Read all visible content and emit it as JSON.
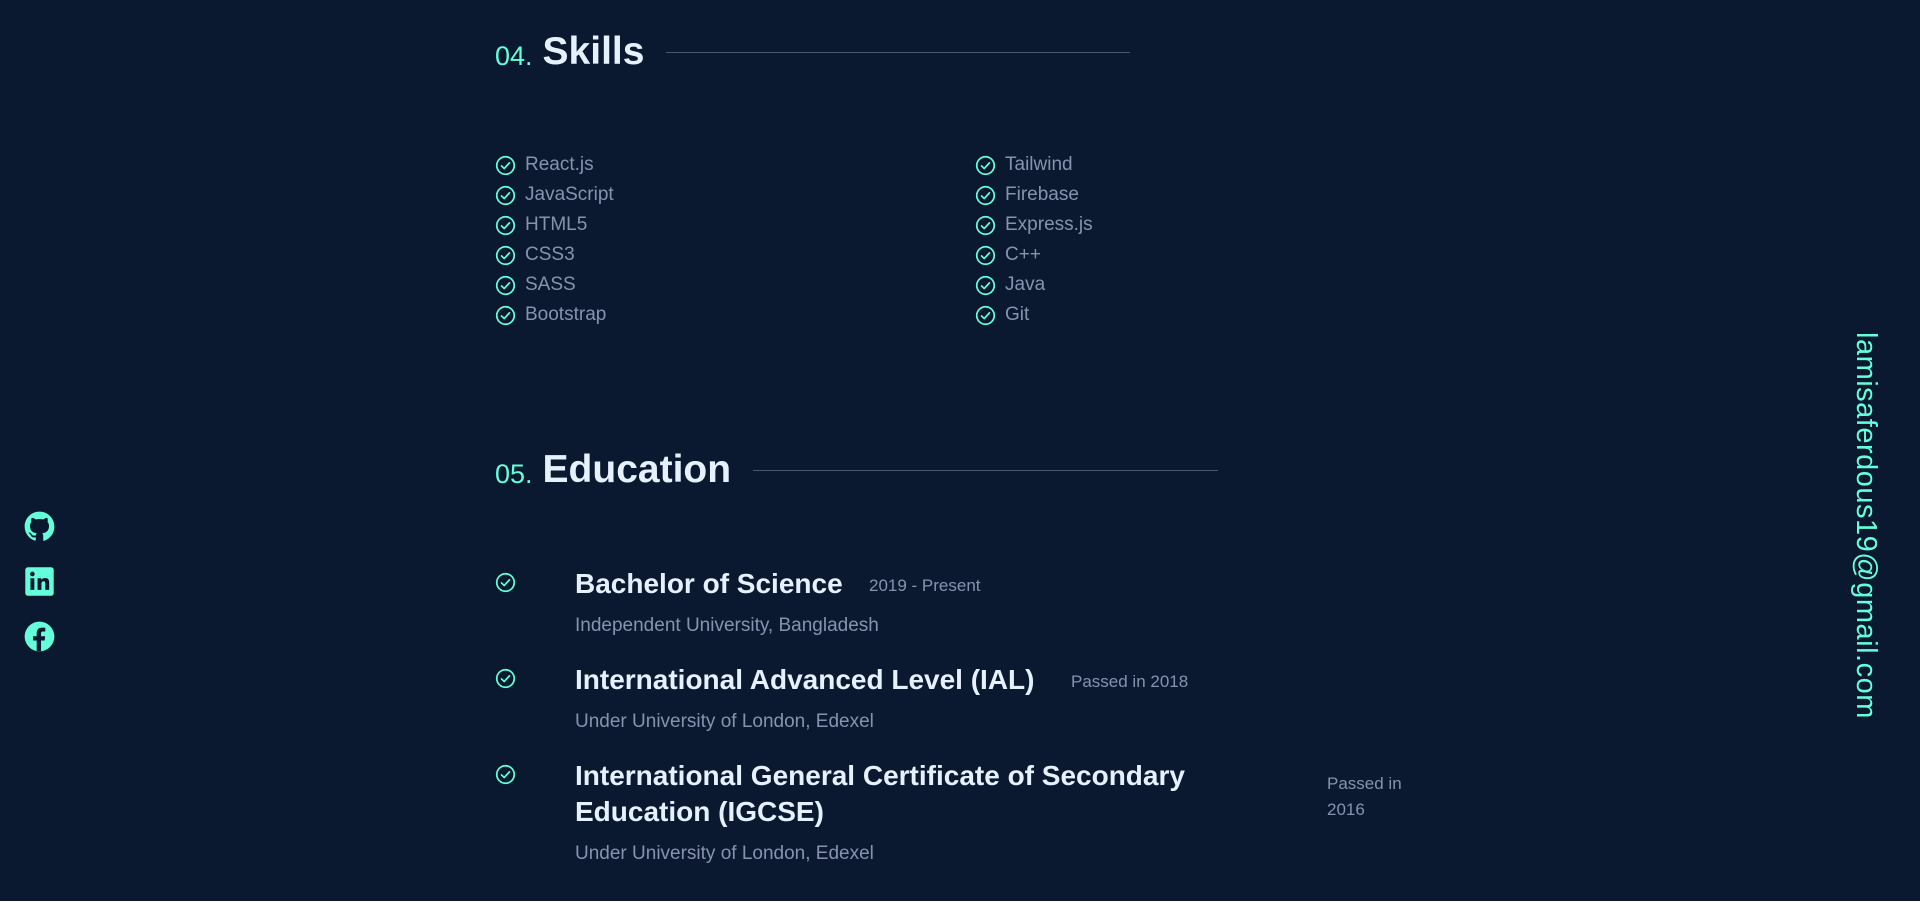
{
  "colors": {
    "background": "#0a192f",
    "accent": "#64ffda",
    "heading": "#e6f1ff",
    "body_text": "#8892b0",
    "divider": "#495670"
  },
  "skills_section": {
    "number": "04.",
    "title": "Skills",
    "left_column": [
      "React.js",
      "JavaScript",
      "HTML5",
      "CSS3",
      "SASS",
      "Bootstrap"
    ],
    "right_column": [
      "Tailwind",
      "Firebase",
      "Express.js",
      "C++",
      "Java",
      "Git"
    ],
    "item_icon": "check-circle-icon"
  },
  "education_section": {
    "number": "05.",
    "title": "Education",
    "items": [
      {
        "degree": "Bachelor of Science",
        "date": "2019 - Present",
        "school": "Independent University, Bangladesh"
      },
      {
        "degree": "International Advanced Level (IAL)",
        "date": "Passed in 2018",
        "school": "Under University of London, Edexel"
      },
      {
        "degree_line1": "International General Certificate of Secondary",
        "degree_line2": "Education (IGCSE)",
        "date_line1": "Passed in",
        "date_line2": "2016",
        "school": "Under University of London, Edexel"
      }
    ]
  },
  "social_links": [
    {
      "icon": "github-icon"
    },
    {
      "icon": "linkedin-icon"
    },
    {
      "icon": "facebook-icon"
    }
  ],
  "email": "lamisaferdous19@gmail.com"
}
